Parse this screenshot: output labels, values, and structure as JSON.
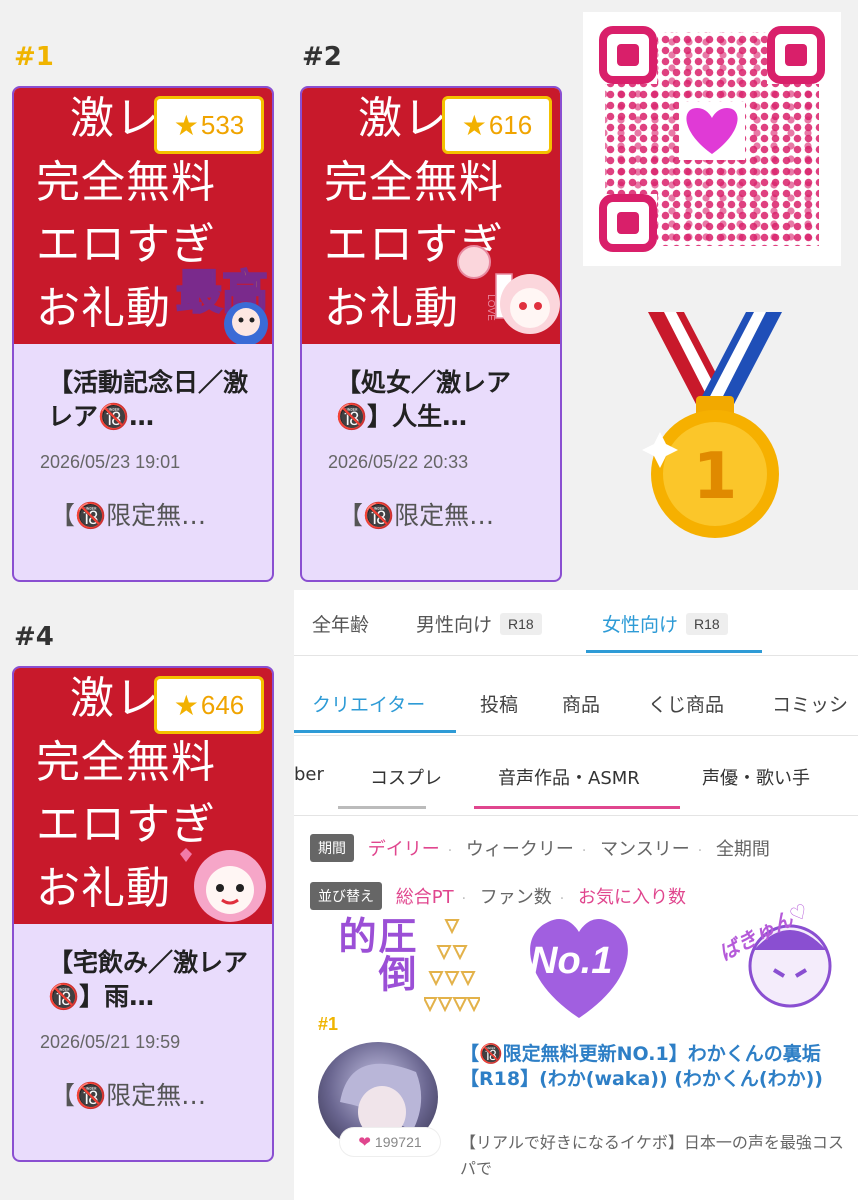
{
  "ranks": {
    "r1": "#1",
    "r2": "#2",
    "r4": "#4"
  },
  "cards": [
    {
      "score": "533",
      "thumb_lines": [
        "激レ",
        "完全無料",
        "エロすぎ",
        "お礼動"
      ],
      "overlay_text": "最高",
      "title": "【活動記念日／激レア🔞…",
      "date": "2026/05/23 19:01",
      "desc": "【🔞限定無…"
    },
    {
      "score": "616",
      "thumb_lines": [
        "激レ",
        "完全無料",
        "エロすぎ",
        "お礼動"
      ],
      "overlay_text": "LOVE",
      "title": "【処女／激レア🔞】人生…",
      "date": "2026/05/22 20:33",
      "desc": "【🔞限定無…"
    },
    {
      "score": "646",
      "thumb_lines": [
        "激レ",
        "完全無料",
        "エロすぎ",
        "お礼動"
      ],
      "overlay_text": "",
      "title": "【宅飲み／激レア🔞】雨…",
      "date": "2026/05/21 19:59",
      "desc": "【🔞限定無…"
    }
  ],
  "r18_icon_label": "18",
  "medal": {
    "number": "1",
    "icon": "gold-medal-icon"
  },
  "qr": {
    "icon": "qr-code-icon",
    "center": "heart-icon"
  },
  "age_tabs": [
    {
      "label": "全年齢",
      "pill": ""
    },
    {
      "label": "男性向け",
      "pill": "R18"
    },
    {
      "label": "女性向け",
      "pill": "R18"
    }
  ],
  "category_tabs": [
    "クリエイター",
    "投稿",
    "商品",
    "くじ商品",
    "コミッシ"
  ],
  "genre_tabs": [
    "ber",
    "コスプレ",
    "音声作品・ASMR",
    "声優・歌い手"
  ],
  "period": {
    "label": "期間",
    "options": [
      "デイリー",
      "ウィークリー",
      "マンスリー",
      "全期間"
    ]
  },
  "sort": {
    "label": "並び替え",
    "options": [
      "総合PT",
      "ファン数",
      "お気に入り数"
    ]
  },
  "banners": {
    "left": "圧倒的",
    "middle": "No.1",
    "right": "ばきゅん♡"
  },
  "entry": {
    "rank": "#1",
    "likes": "199721",
    "title": "【🔞限定無料更新NO.1】わかくんの裏垢【R18】(わか(waka)) (わかくん(わか))",
    "desc": "【リアルで好きになるイケボ】日本一の声を最強コスパで"
  },
  "colors": {
    "thumb_red": "#c8192b",
    "card_bg": "#e9dcfc",
    "card_border": "#8a4fd1",
    "accent_blue": "#2e9bd6",
    "accent_pink": "#e0468e",
    "gold": "#f0b400"
  }
}
